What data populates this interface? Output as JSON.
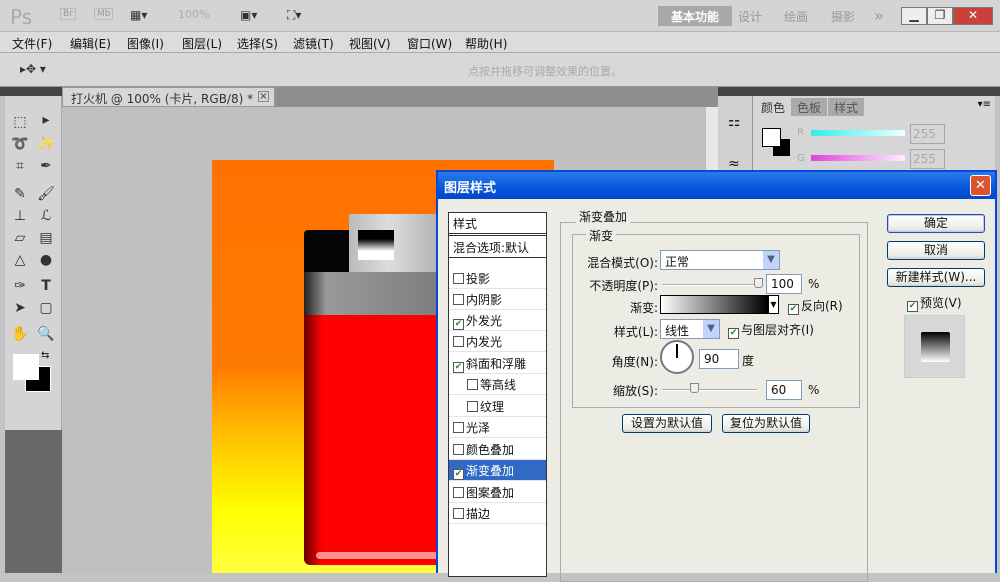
{
  "app": {
    "logo": "Ps",
    "bridge": "Br",
    "minibridge": "Mb",
    "zoom": "100%",
    "workspaces": [
      "基本功能",
      "设计",
      "绘画",
      "摄影"
    ],
    "more": "»",
    "window_controls": [
      "minimize",
      "restore",
      "close"
    ]
  },
  "menu": [
    "文件(F)",
    "编辑(E)",
    "图像(I)",
    "图层(L)",
    "选择(S)",
    "滤镜(T)",
    "视图(V)",
    "窗口(W)",
    "帮助(H)"
  ],
  "options": {
    "hint": "点按并拖移可调整效果的位置。"
  },
  "document": {
    "tab": "打火机 @ 100% (卡片, RGB/8) *"
  },
  "colors": {
    "accent": "#316ac5",
    "titlebar": "#0755dc",
    "background_top": "#ff7200",
    "background_bottom": "#ffff00",
    "lighter_body": "#ff0000"
  },
  "color_panel": {
    "tabs": [
      "颜色",
      "色板",
      "样式"
    ],
    "r_label": "R",
    "r_value": "255",
    "g_label": "G",
    "g_value": "255"
  },
  "dialog": {
    "title": "图层样式",
    "list_header": "样式",
    "items": [
      {
        "label": "混合选项:默认",
        "checkbox": false,
        "has_checkbox": false
      },
      {
        "label": "投影",
        "checked": false
      },
      {
        "label": "内阴影",
        "checked": false
      },
      {
        "label": "外发光",
        "checked": true
      },
      {
        "label": "内发光",
        "checked": false
      },
      {
        "label": "斜面和浮雕",
        "checked": true
      },
      {
        "label": "等高线",
        "checked": false,
        "indent": true
      },
      {
        "label": "纹理",
        "checked": false,
        "indent": true
      },
      {
        "label": "光泽",
        "checked": false
      },
      {
        "label": "颜色叠加",
        "checked": false
      },
      {
        "label": "渐变叠加",
        "checked": true,
        "selected": true
      },
      {
        "label": "图案叠加",
        "checked": false
      },
      {
        "label": "描边",
        "checked": false
      }
    ],
    "section": "渐变叠加",
    "subsection": "渐变",
    "blend_mode_label": "混合模式(O):",
    "blend_mode": "正常",
    "opacity_label": "不透明度(P):",
    "opacity": "100",
    "opacity_unit": "%",
    "gradient_label": "渐变:",
    "reverse_label": "反向(R)",
    "reverse": true,
    "style_label": "样式(L):",
    "style": "线性",
    "align_label": "与图层对齐(I)",
    "align": true,
    "angle_label": "角度(N):",
    "angle": "90",
    "angle_unit": "度",
    "scale_label": "缩放(S):",
    "scale": "60",
    "scale_unit": "%",
    "set_default": "设置为默认值",
    "reset_default": "复位为默认值",
    "ok": "确定",
    "cancel": "取消",
    "new_style": "新建样式(W)...",
    "preview_label": "预览(V)",
    "preview": true
  }
}
